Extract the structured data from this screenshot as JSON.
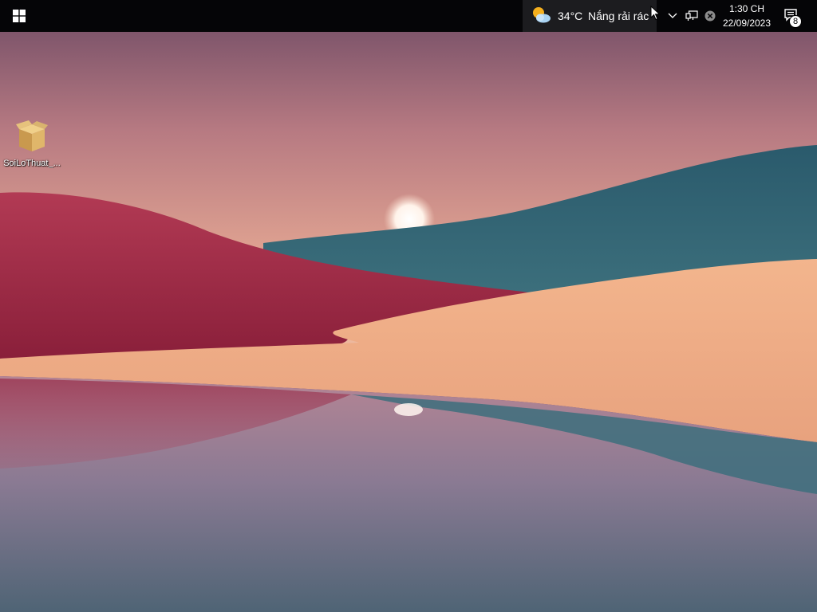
{
  "desktop": {
    "icons": [
      {
        "label": "SoiLoThuat_...",
        "icon": "package-box-icon"
      }
    ],
    "wallpaper": "sunset-hills-lake"
  },
  "taskbar": {
    "start_icon": "windows-logo-icon",
    "weather": {
      "temperature": "34°C",
      "condition": "Nắng rải rác",
      "icon": "sun-cloud-icon"
    },
    "tray": {
      "icons": [
        "chevron-up-icon",
        "network-icon",
        "close-circle-icon"
      ]
    },
    "clock": {
      "time": "1:30 CH",
      "date": "22/09/2023"
    },
    "notifications": {
      "icon": "action-center-icon",
      "count": "8"
    }
  },
  "colors": {
    "taskbar": "#050507",
    "weather_widget_bg": "#1c1c1f"
  }
}
